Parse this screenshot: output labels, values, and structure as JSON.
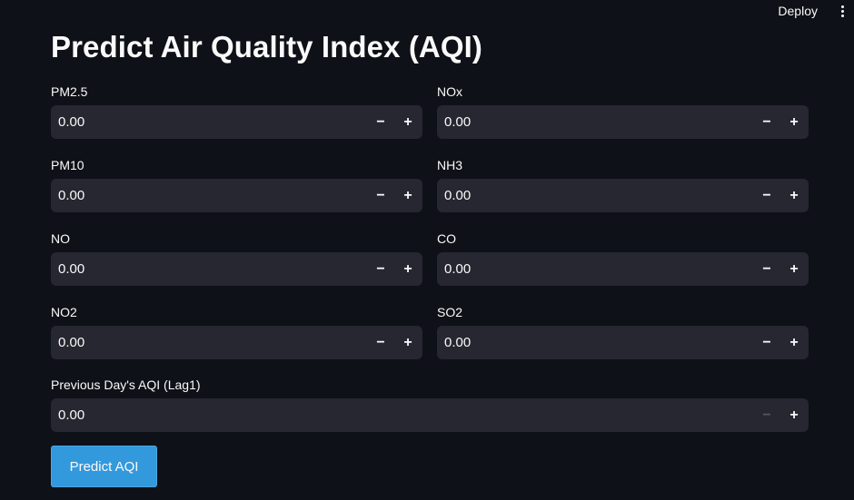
{
  "header": {
    "deploy_label": "Deploy",
    "menu_icon": "vertical-ellipsis-icon"
  },
  "page": {
    "title": "Predict Air Quality Index (AQI)"
  },
  "fields": {
    "pm25": {
      "label": "PM2.5",
      "value": "0.00"
    },
    "nox": {
      "label": "NOx",
      "value": "0.00"
    },
    "pm10": {
      "label": "PM10",
      "value": "0.00"
    },
    "nh3": {
      "label": "NH3",
      "value": "0.00"
    },
    "no": {
      "label": "NO",
      "value": "0.00"
    },
    "co": {
      "label": "CO",
      "value": "0.00"
    },
    "no2": {
      "label": "NO2",
      "value": "0.00"
    },
    "so2": {
      "label": "SO2",
      "value": "0.00"
    },
    "lag1": {
      "label": "Previous Day's AQI (Lag1)",
      "value": "0.00"
    }
  },
  "stepper": {
    "minus": "−",
    "plus": "+"
  },
  "actions": {
    "predict_label": "Predict AQI"
  },
  "colors": {
    "background": "#0e1117",
    "input_bg": "#262730",
    "button_bg": "#3399dd",
    "text": "#fafafa"
  }
}
